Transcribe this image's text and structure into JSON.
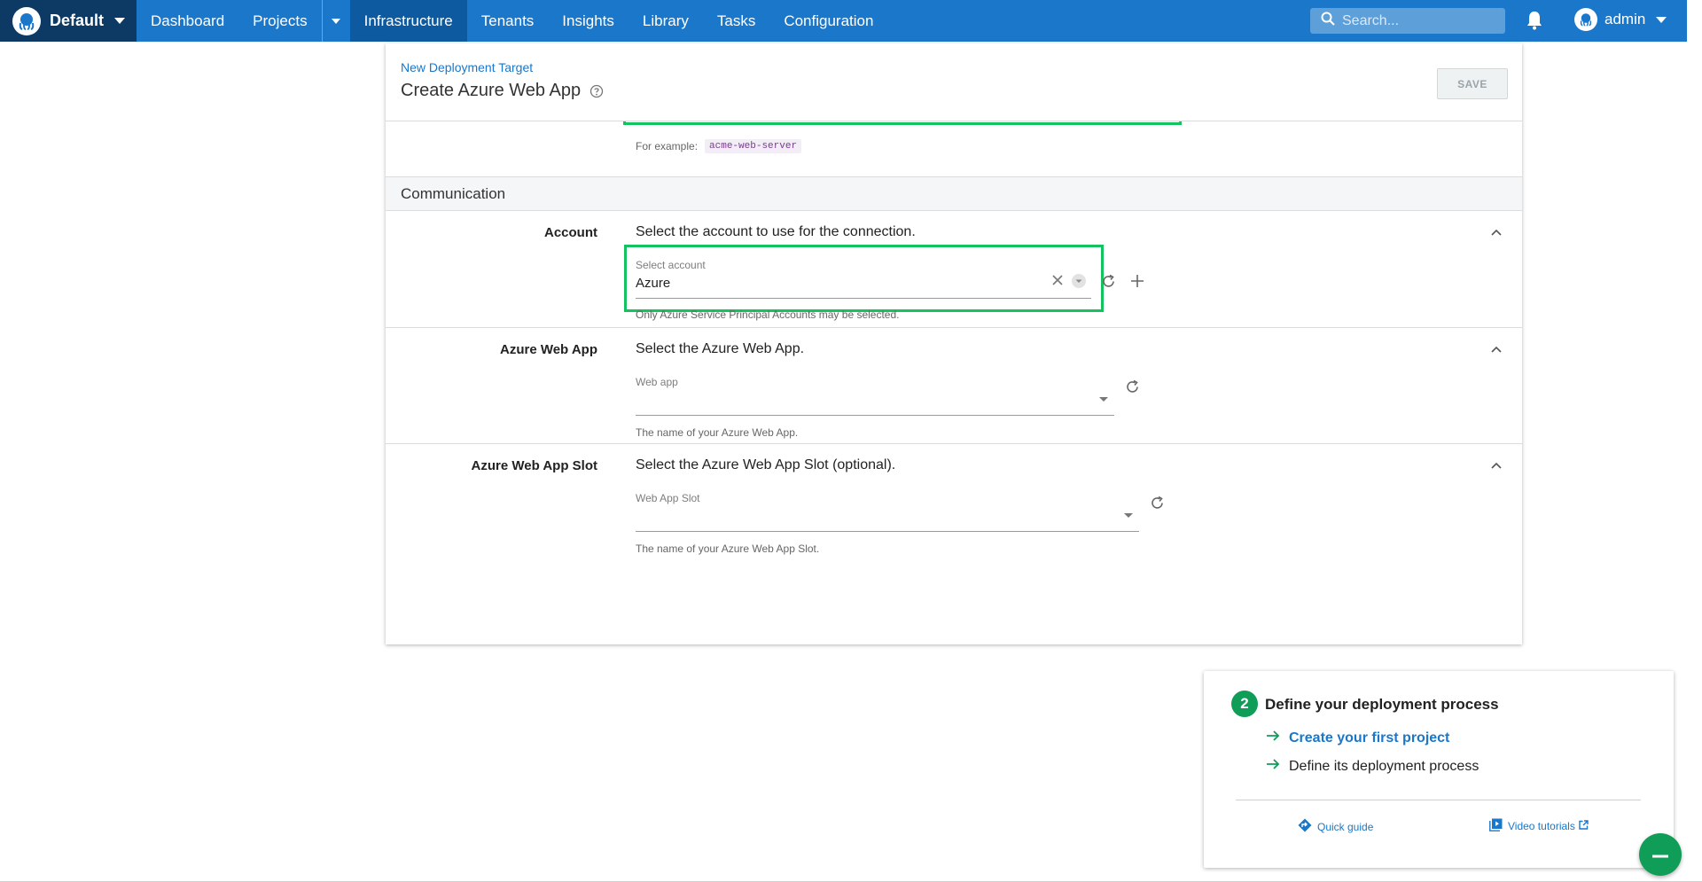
{
  "topnav": {
    "space_name": "Default",
    "items": [
      {
        "label": "Dashboard"
      },
      {
        "label": "Projects"
      },
      {
        "label": "Infrastructure"
      },
      {
        "label": "Tenants"
      },
      {
        "label": "Insights"
      },
      {
        "label": "Library"
      },
      {
        "label": "Tasks"
      },
      {
        "label": "Configuration"
      }
    ],
    "active": "Infrastructure",
    "search_placeholder": "Search...",
    "user_name": "admin",
    "brand_color": "#1a77ca"
  },
  "header": {
    "breadcrumb": "New Deployment Target",
    "title": "Create Azure Web App",
    "save_label": "SAVE"
  },
  "name_field": {
    "example_prefix": "For example:",
    "example_value": "acme-web-server"
  },
  "section": {
    "title": "Communication"
  },
  "account": {
    "label": "Account",
    "description": "Select the account to use for the connection.",
    "float_label": "Select account",
    "value": "Azure",
    "helper": "Only Azure Service Principal Accounts may be selected."
  },
  "web_app": {
    "label": "Azure Web App",
    "description": "Select the Azure Web App.",
    "float_label": "Web app",
    "value": "",
    "helper": "The name of your Azure Web App."
  },
  "web_app_slot": {
    "label": "Azure Web App Slot",
    "description": "Select the Azure Web App Slot (optional).",
    "float_label": "Web App Slot",
    "value": "",
    "helper": "The name of your Azure Web App Slot."
  },
  "onboarding": {
    "step": "2",
    "title": "Define your deployment process",
    "items": [
      {
        "label": "Create your first project",
        "link": true
      },
      {
        "label": "Define its deployment process",
        "link": false
      }
    ],
    "quick_guide": "Quick guide",
    "video_tutorials": "Video tutorials",
    "accent": "#0f9d58"
  },
  "highlight_color": "#14c25f"
}
